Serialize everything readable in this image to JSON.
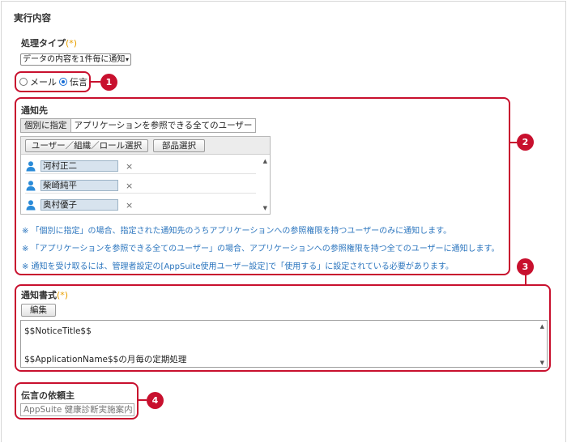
{
  "section_title": "実行内容",
  "process_type": {
    "label": "処理タイプ",
    "required_mark": "(*)",
    "selected": "データの内容を1件毎に通知",
    "arrow": "▾"
  },
  "method": {
    "options": [
      {
        "label": "メール",
        "checked": false
      },
      {
        "label": "伝言",
        "checked": true
      }
    ]
  },
  "notification_target": {
    "label": "通知先",
    "tabs": [
      {
        "label": "個別に指定",
        "active": true
      },
      {
        "label": "アプリケーションを参照できる全てのユーザー",
        "active": false
      }
    ],
    "select_user_button": "ユーザー／組織／ロール選択",
    "select_part_button": "部品選択",
    "users": [
      "河村正二",
      "柴崎純平",
      "奥村優子"
    ],
    "remove_icon": "×",
    "notes": [
      "※ 「個別に指定」の場合、指定された通知先のうちアプリケーションへの参照権限を持つユーザーのみに通知します。",
      "※ 「アプリケーションを参照できる全てのユーザー」の場合、アプリケーションへの参照権限を持つ全てのユーザーに通知します。",
      "※ 通知を受け取るには、管理者設定の[AppSuite使用ユーザー設定]で「使用する」に設定されている必要があります。"
    ]
  },
  "notification_format": {
    "label": "通知書式",
    "required_mark": "(*)",
    "edit_button": "編集",
    "lines": [
      "$$NoticeTitle$$",
      "$$ApplicationName$$の月毎の定期処理"
    ]
  },
  "requester": {
    "label": "伝言の依頼主",
    "placeholder": "AppSuite 健康診断実施案内"
  },
  "callouts": [
    "1",
    "2",
    "3",
    "4"
  ],
  "colors": {
    "callout_red": "#c8102e",
    "note_blue": "#2b75be",
    "required_orange": "#e8a000",
    "user_blue": "#2a8bd8"
  }
}
